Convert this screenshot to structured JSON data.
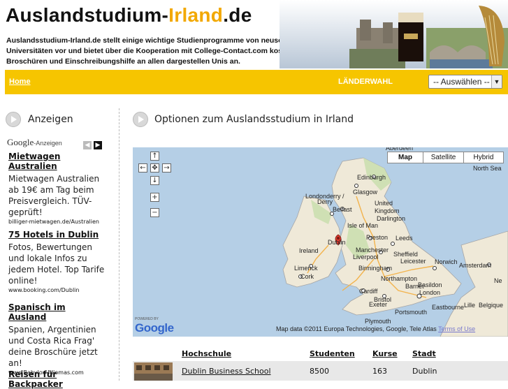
{
  "header": {
    "logo_prefix": "Auslandstudium-",
    "logo_highlight": "Irland",
    "logo_suffix": ".de",
    "intro": "Auslandsstudium-Irland.de stellt einige wichtige Studienprogramme von neuseeländischen Universitäten vor und bietet über die Kooperation mit College-Contact.com kostenlose Beratung, Broschüren und Einschreibungshilfe an allen dargestellen Unis an."
  },
  "nav": {
    "home": "Home",
    "laenderwahl": "LÄNDERWAHL",
    "select_value": "-- Auswählen --"
  },
  "sidebar": {
    "title": "Anzeigen",
    "google_label": "Google",
    "ads_label": "-Anzeigen",
    "ads": [
      {
        "title": "Mietwagen Australien",
        "desc": "Mietwagen Australien ab 19€ am Tag beim Preisvergleich. TÜV-geprüft!",
        "url": "billiger-mietwagen.de/Australien"
      },
      {
        "title": "75 Hotels in Dublin",
        "desc": "Fotos, Bewertungen und lokale Infos zu jedem Hotel. Top Tarife online!",
        "url": "www.booking.com/Dublin"
      },
      {
        "title": "Spanisch im Ausland",
        "desc": "Spanien, Argentinien und Costa Rica Frag' deine Broschüre jetzt an!",
        "url": "www.Babylon-Idiomas.com"
      },
      {
        "title": "Reisen für Backpacker",
        "desc": "",
        "url": ""
      }
    ]
  },
  "main": {
    "title": "Optionen zum Auslandsstudium in Irland"
  },
  "map": {
    "types": [
      "Map",
      "Satellite",
      "Hybrid"
    ],
    "active_type": "Map",
    "attribution": "Map data ©2011 Europa Technologies, Google, Tele Atlas",
    "terms": "Terms of Use",
    "powered_by": "POWERED BY",
    "google": "Google",
    "labels": [
      "Aberdeen",
      "North Sea",
      "Edinburgh",
      "Glasgow",
      "Londonderry / Derry",
      "Belfast",
      "United Kingdom",
      "Isle of Man",
      "Darlington",
      "Preston",
      "Leeds",
      "Ireland",
      "Dublin",
      "Manchester",
      "Liverpool",
      "Sheffield",
      "Limerick",
      "Cork",
      "Birmingham",
      "Leicester",
      "Norwich",
      "Amsterdam",
      "Northampton",
      "Cardiff",
      "Bristol",
      "Barnet",
      "London",
      "Basildon",
      "Exeter",
      "Plymouth",
      "Portsmouth",
      "Eastbourne",
      "Lille",
      "Belgique",
      "Netherlands"
    ],
    "colors": {
      "sea": "#b5cfe6",
      "land": "#efe9d8",
      "green": "#cfe0b4"
    }
  },
  "table": {
    "headers": [
      "Hochschule",
      "Studenten",
      "Kurse",
      "Stadt"
    ],
    "rows": [
      {
        "name": "Dublin Business School",
        "students": "8500",
        "courses": "163",
        "city": "Dublin"
      }
    ]
  }
}
